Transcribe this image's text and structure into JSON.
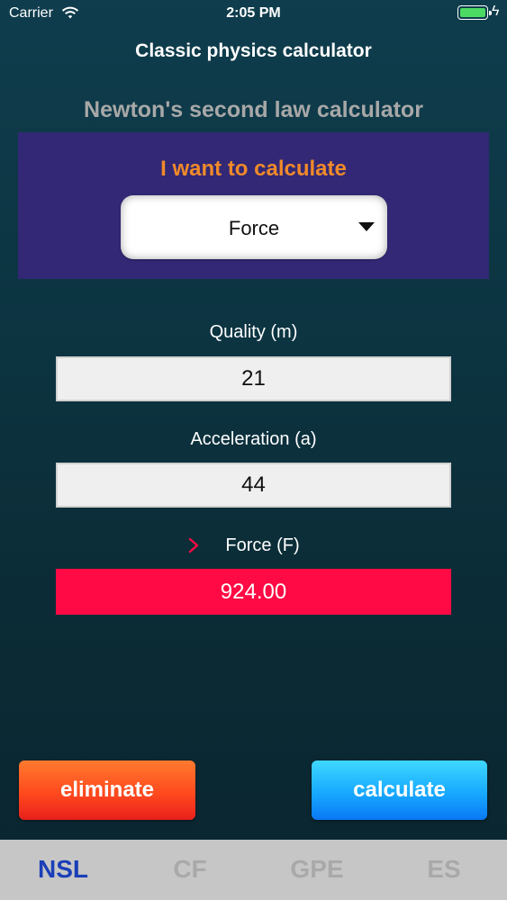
{
  "status_bar": {
    "carrier": "Carrier",
    "time": "2:05 PM",
    "battery_color": "#4cd964"
  },
  "nav": {
    "title": "Classic physics calculator"
  },
  "page": {
    "heading": "Newton's second law calculator"
  },
  "selector": {
    "prompt": "I want to calculate",
    "selected": "Force",
    "panel_color": "#322876",
    "prompt_color": "#f08a2a"
  },
  "fields": {
    "mass": {
      "label": "Quality (m)",
      "value": "21"
    },
    "acceleration": {
      "label": "Acceleration (a)",
      "value": "44"
    }
  },
  "result": {
    "label": "Force (F)",
    "value": "924.00",
    "color": "#ff0a44"
  },
  "buttons": {
    "eliminate": "eliminate",
    "calculate": "calculate"
  },
  "tabs": [
    {
      "label": "NSL",
      "active": true
    },
    {
      "label": "CF",
      "active": false
    },
    {
      "label": "GPE",
      "active": false
    },
    {
      "label": "ES",
      "active": false
    }
  ],
  "accent_color": "#1a3fb8"
}
